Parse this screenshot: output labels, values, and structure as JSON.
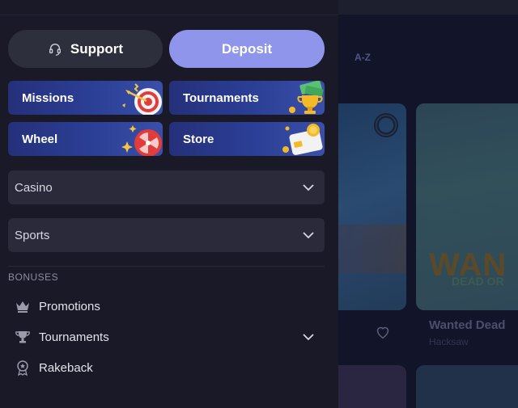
{
  "sidebar": {
    "actions": {
      "support_label": "Support",
      "deposit_label": "Deposit"
    },
    "tiles": [
      {
        "label": "Missions",
        "icon": "target-dart-icon"
      },
      {
        "label": "Tournaments",
        "icon": "trophy-cash-icon"
      },
      {
        "label": "Wheel",
        "icon": "prize-wheel-icon"
      },
      {
        "label": "Store",
        "icon": "coin-card-icon"
      }
    ],
    "dropdowns": [
      {
        "label": "Casino"
      },
      {
        "label": "Sports"
      }
    ],
    "bonuses": {
      "heading": "BONUSES",
      "items": [
        {
          "label": "Promotions",
          "icon": "crown-icon"
        },
        {
          "label": "Tournaments",
          "icon": "trophy-icon",
          "expandable": true
        },
        {
          "label": "Rakeback",
          "icon": "medal-icon"
        }
      ]
    }
  },
  "background": {
    "filter_label": "A-Z",
    "game_card": {
      "art_title": "WAN",
      "art_subtitle": "DEAD OR",
      "title": "Wanted Dead",
      "provider": "Hacksaw"
    }
  },
  "colors": {
    "sidebar_bg": "#191927",
    "deposit_accent": "#8f95ea",
    "support_bg": "#2e2f3d",
    "tile_gradient_start": "#25307a",
    "tile_gradient_end": "#3a4fa8",
    "dropdown_bg": "#2a2a3a"
  }
}
